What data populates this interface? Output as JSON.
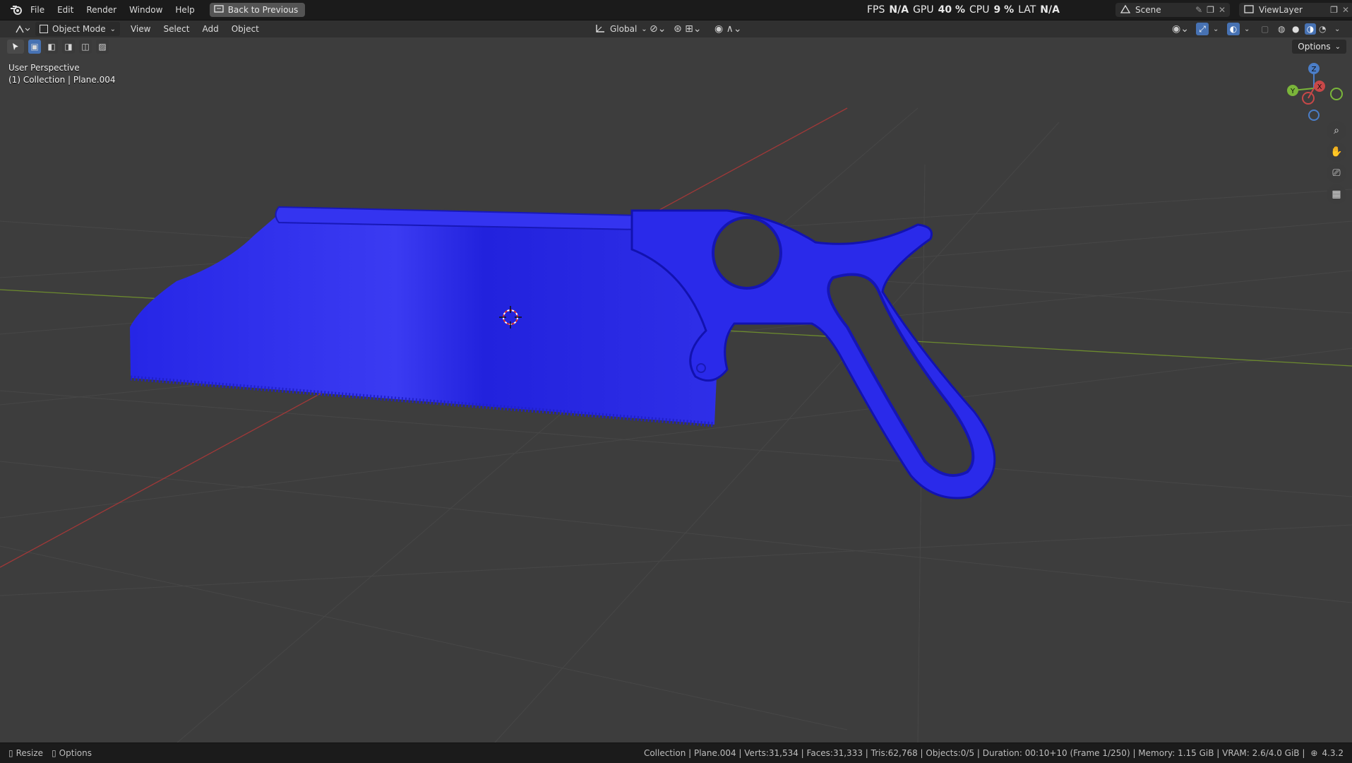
{
  "topbar": {
    "menus": [
      "File",
      "Edit",
      "Render",
      "Window",
      "Help"
    ],
    "back_label": "Back to Previous",
    "stats": {
      "fps_label": "FPS",
      "fps_val": "N/A",
      "gpu_label": "GPU",
      "gpu_val": "40 %",
      "cpu_label": "CPU",
      "cpu_val": "9 %",
      "lat_label": "LAT",
      "lat_val": "N/A"
    },
    "scene": "Scene",
    "viewlayer": "ViewLayer"
  },
  "header": {
    "mode": "Object Mode",
    "menus": [
      "View",
      "Select",
      "Add",
      "Object"
    ],
    "orientation": "Global",
    "options_label": "Options"
  },
  "viewport": {
    "perspective": "User Perspective",
    "collection_info": "(1) Collection | Plane.004",
    "gizmo": {
      "x": "X",
      "y": "Y",
      "z": "Z"
    },
    "object_color": "#2020e0"
  },
  "statusbar": {
    "left1": "Resize",
    "left2": "Options",
    "info": "Collection | Plane.004 | Verts:31,534 | Faces:31,333 | Tris:62,768 | Objects:0/5 | Duration: 00:10+10 (Frame 1/250) | Memory: 1.15 GiB | VRAM: 2.6/4.0 GiB |",
    "version": "4.3.2"
  }
}
